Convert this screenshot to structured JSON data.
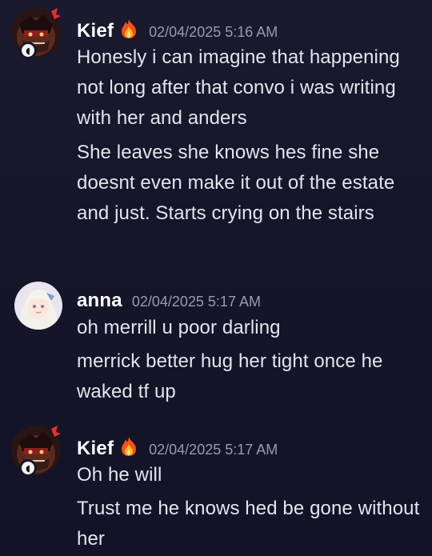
{
  "messages": [
    {
      "author": "Kief",
      "author_emoji": "fire-emoji",
      "timestamp": "02/04/2025 5:16 AM",
      "lines": [
        "Honesly i can imagine that happening not long after that convo i was writing with her and anders",
        "She leaves she knows hes fine she doesnt even make it out of the estate and just. Starts crying on the stairs"
      ]
    },
    {
      "author": "anna",
      "timestamp": "02/04/2025 5:17 AM",
      "lines": [
        "oh merrill u poor darling",
        "merrick better hug her tight once he waked tf up"
      ]
    },
    {
      "author": "Kief",
      "author_emoji": "fire-emoji",
      "timestamp": "02/04/2025 5:17 AM",
      "lines": [
        "Oh he will",
        "Trust me he knows hed be gone without her"
      ]
    }
  ],
  "colors": {
    "background": "#17172b",
    "username": "#ffffff",
    "timestamp": "#9a9aae",
    "message_text": "#e4e4ee"
  }
}
